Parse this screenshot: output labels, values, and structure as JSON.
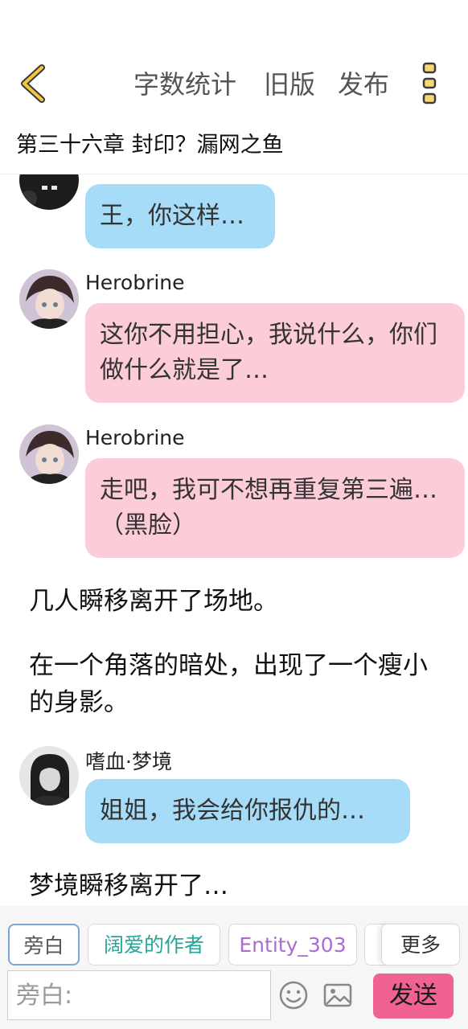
{
  "toolbar": {
    "word_count_label": "字数统计",
    "old_version_label": "旧版",
    "publish_label": "发布"
  },
  "chapter": {
    "title": "第三十六章 封印？漏网之鱼"
  },
  "messages": [
    {
      "type": "bubble",
      "side": "left",
      "color": "blue",
      "sender": "",
      "text": "王，你这样…"
    },
    {
      "type": "bubble",
      "side": "left",
      "color": "pink",
      "sender": "Herobrine",
      "text": "这你不用担心，我说什么，你们做什么就是了…"
    },
    {
      "type": "bubble",
      "side": "left",
      "color": "pink",
      "sender": "Herobrine",
      "text": "走吧，我可不想再重复第三遍…（黑脸）"
    },
    {
      "type": "narration",
      "text": "几人瞬移离开了场地。"
    },
    {
      "type": "narration",
      "text": "在一个角落的暗处，出现了一个瘦小的身影。"
    },
    {
      "type": "bubble",
      "side": "left",
      "color": "blue",
      "sender": "嗜血·梦境",
      "text": "姐姐，我会给你报仇的…"
    },
    {
      "type": "narration",
      "text": "梦境瞬移离开了…"
    }
  ],
  "roles": [
    {
      "label": "旁白",
      "color": "#555555"
    },
    {
      "label": "阔爱的作者",
      "color": "#26a69a"
    },
    {
      "label": "Entity_303",
      "color": "#ab6bcf"
    },
    {
      "label": "",
      "color": "#555555"
    }
  ],
  "more_label": "更多",
  "input": {
    "placeholder": "旁白:"
  },
  "send_label": "发送",
  "colors": {
    "accent": "#f06292",
    "blue_bubble": "#a6dcf7",
    "pink_bubble": "#fccdd9",
    "back_icon": "#f2c73d"
  }
}
